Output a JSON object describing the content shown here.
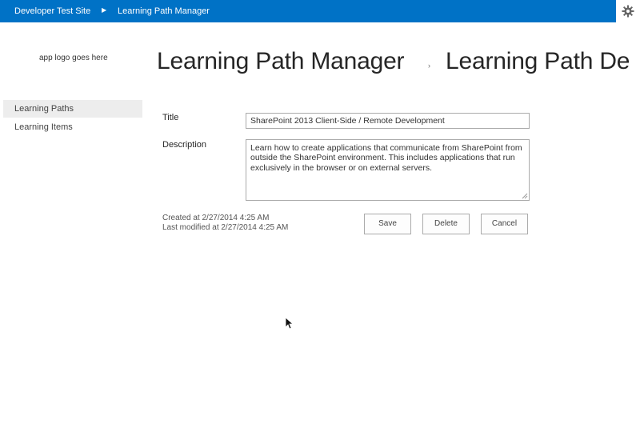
{
  "topbar": {
    "site_link": "Developer Test Site",
    "separator": "▶",
    "app_link": "Learning Path Manager",
    "settings_icon": "gear-icon"
  },
  "logo": {
    "text": "app logo goes here"
  },
  "header": {
    "title": "Learning Path Manager",
    "separator": "›",
    "subtitle": "Learning Path De"
  },
  "nav": {
    "items": [
      {
        "label": "Learning Paths",
        "selected": true
      },
      {
        "label": "Learning Items",
        "selected": false
      }
    ]
  },
  "form": {
    "title_label": "Title",
    "title_value": "SharePoint 2013 Client-Side / Remote Development",
    "description_label": "Description",
    "description_value": "Learn how to create applications that communicate from SharePoint from outside the SharePoint environment. This includes applications that run exclusively in the browser or on external servers.",
    "created": "Created at 2/27/2014 4:25 AM",
    "modified": "Last modified at 2/27/2014 4:25 AM"
  },
  "buttons": {
    "save": "Save",
    "delete": "Delete",
    "cancel": "Cancel"
  },
  "colors": {
    "suite_bar": "#0072c6",
    "nav_selected": "#ededed"
  }
}
